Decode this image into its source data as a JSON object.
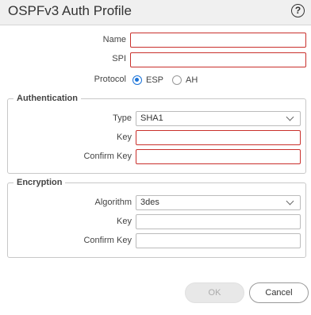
{
  "dialog": {
    "title": "OSPFv3 Auth Profile",
    "help_icon": "?"
  },
  "fields": {
    "name_label": "Name",
    "name_value": "",
    "spi_label": "SPI",
    "spi_value": "",
    "protocol_label": "Protocol",
    "protocol_options": [
      "ESP",
      "AH"
    ],
    "protocol_selected": "ESP"
  },
  "authentication": {
    "legend": "Authentication",
    "type_label": "Type",
    "type_value": "SHA1",
    "key_label": "Key",
    "key_value": "",
    "confirm_key_label": "Confirm Key",
    "confirm_key_value": ""
  },
  "encryption": {
    "legend": "Encryption",
    "algorithm_label": "Algorithm",
    "algorithm_value": "3des",
    "key_label": "Key",
    "key_value": "",
    "confirm_key_label": "Confirm Key",
    "confirm_key_value": ""
  },
  "buttons": {
    "ok": "OK",
    "cancel": "Cancel"
  },
  "colors": {
    "error_border": "#c9302c",
    "radio_accent": "#1a73d9"
  }
}
